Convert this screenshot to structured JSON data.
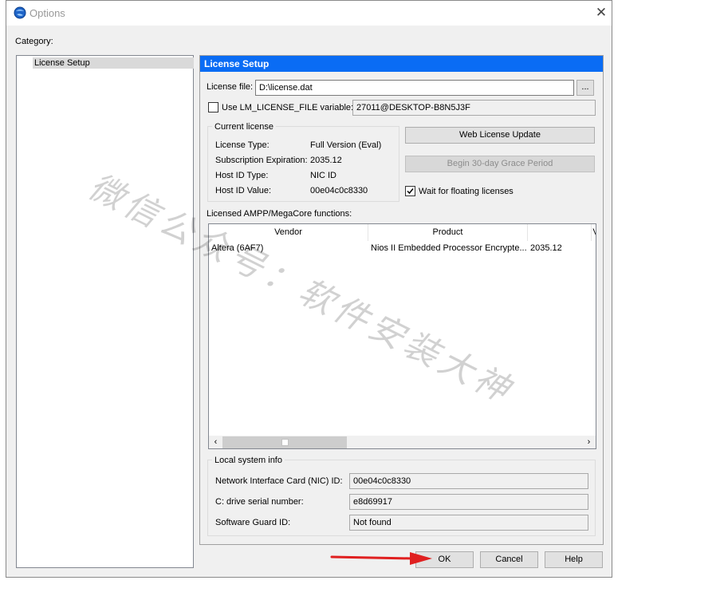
{
  "window": {
    "title": "Options",
    "close_glyph": "✕"
  },
  "category": {
    "label": "Category:",
    "items": [
      "License Setup"
    ]
  },
  "panel": {
    "header": "License Setup",
    "license_file_label": "License file:",
    "license_file_value": "D:\\license.dat",
    "browse_label": "...",
    "use_lm_label": "Use LM_LICENSE_FILE variable:",
    "use_lm_checked": false,
    "use_lm_value": "27011@DESKTOP-B8N5J3F",
    "current_license": {
      "title": "Current license",
      "rows": [
        {
          "label": "License Type:",
          "value": "Full Version (Eval)"
        },
        {
          "label": "Subscription Expiration:",
          "value": "2035.12"
        },
        {
          "label": "Host ID Type:",
          "value": "NIC ID"
        },
        {
          "label": "Host ID Value:",
          "value": "00e04c0c8330"
        }
      ]
    },
    "web_update_label": "Web License Update",
    "grace_label": "Begin 30-day Grace Period",
    "wait_label": "Wait for floating licenses",
    "wait_checked": true,
    "functions_label": "Licensed AMPP/MegaCore functions:",
    "table": {
      "columns": [
        "Vendor",
        "Product",
        "",
        "V"
      ],
      "rows": [
        [
          "Altera (6AF7)",
          "Nios II Embedded Processor Encrypte...",
          "2035.12"
        ]
      ]
    },
    "local_info": {
      "title": "Local system info",
      "rows": [
        {
          "label": "Network Interface Card (NIC) ID:",
          "value": "00e04c0c8330"
        },
        {
          "label": "C: drive serial number:",
          "value": "e8d69917"
        },
        {
          "label": "Software Guard ID:",
          "value": "Not found"
        }
      ]
    }
  },
  "buttons": {
    "ok": "OK",
    "cancel": "Cancel",
    "help": "Help"
  },
  "watermark": "微信公众号：软件安装大神",
  "colors": {
    "header_blue": "#0a6cf4",
    "arrow_red": "#e02020"
  },
  "icons": {
    "app": "globe-icon",
    "close": "close-icon",
    "check": "checkmark-icon",
    "scroll_left": "chevron-left-icon",
    "scroll_right": "chevron-right-icon"
  }
}
